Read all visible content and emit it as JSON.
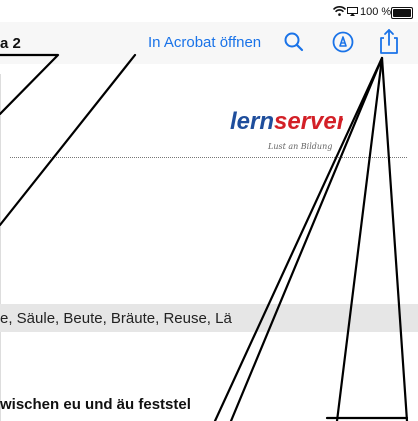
{
  "status_bar": {
    "battery_text": "100 %",
    "icons": [
      "wifi-icon",
      "screen-mirroring-icon",
      "battery-icon"
    ]
  },
  "toolbar": {
    "doc_title": "a 2",
    "open_in_acrobat": "In Acrobat öffnen",
    "accent_color": "#1a73e8",
    "icons": [
      "search-icon",
      "markup-icon",
      "share-icon"
    ]
  },
  "document": {
    "logo_main": "lernserver",
    "logo_tagline": "Lust an Bildung",
    "word_list": "e, Säule, Beute, Bräute, Reuse, Lä",
    "instruction": "wischen eu und äu feststel"
  }
}
